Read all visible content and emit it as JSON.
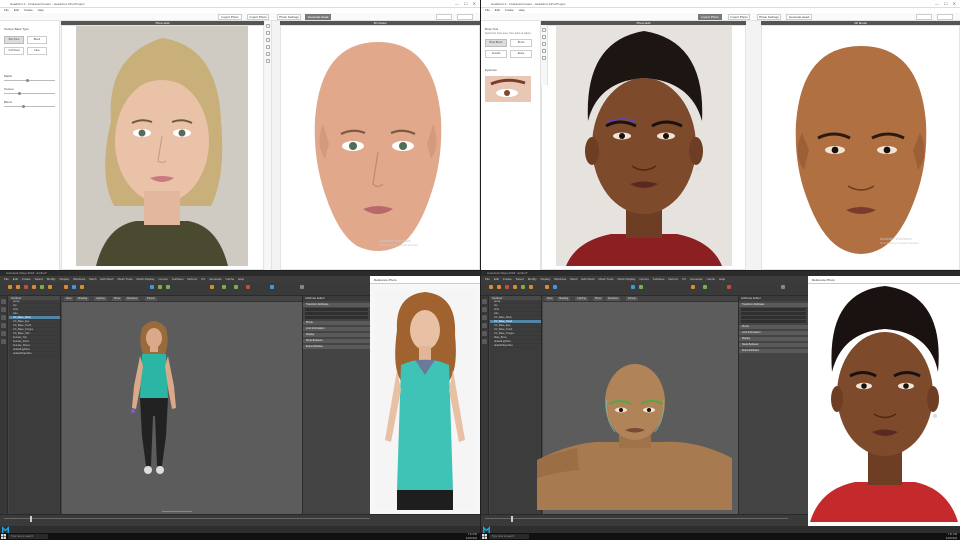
{
  "panels": {
    "top_left": {
      "title": "Headshot 2 - CharacterCreator - Headshot-AP.ccProject",
      "menu": [
        "File",
        "Edit",
        "Create",
        "Help"
      ],
      "toolbar": [
        "Import Photo",
        "Import Photo",
        "Photo Settings",
        "Generate Head"
      ],
      "photo_header": "Photo Edit",
      "result_header": "3D Model",
      "side": {
        "heading": "Texture Bake Type",
        "options": [
          "Skin Tone",
          "Blend",
          "Full Head",
          "Face"
        ],
        "sliders": [
          "Match",
          "Texture",
          "Blend"
        ]
      },
      "watermark_1": "Activate Windows",
      "watermark_2": "Go to Settings to activate Windows."
    },
    "top_right": {
      "title": "Headshot 2 - CharacterCreator - Headshot-AP.ccProject",
      "menu": [
        "File",
        "Edit",
        "Create",
        "Help"
      ],
      "toolbar": [
        "Import Photo",
        "Import Photo",
        "Photo Settings",
        "Generate Head"
      ],
      "photo_header": "Photo Edit",
      "result_header": "3D Model",
      "side": {
        "heading": "Brow Tool",
        "hint": "Select the brow area, then paint to adjust",
        "options": [
          "Brow Brush",
          "Brush",
          "Smooth",
          "Erase"
        ],
        "section": "Eyebrow"
      },
      "watermark_1": "Activate Windows",
      "watermark_2": "Go to Settings to activate Windows."
    },
    "bottom_left": {
      "title": "Autodesk Maya 2018: untitled*",
      "menu": [
        "File",
        "Edit",
        "Create",
        "Select",
        "Modify",
        "Display",
        "Windows",
        "Mesh",
        "Edit Mesh",
        "Mesh Tools",
        "Mesh Display",
        "Curves",
        "Surfaces",
        "Deform",
        "UV",
        "Generate",
        "Cache",
        "Help"
      ],
      "outliner_title": "Outliner",
      "outliner_rows": [
        "persp",
        "top",
        "front",
        "side",
        "CC_Base_Body",
        "CC_Base_Eye",
        "CC_Base_Teeth",
        "CC_Base_Tongue",
        "CC_Base_Hair",
        "Female_Top",
        "Female_Pants",
        "Female_Shoes",
        "defaultLightSet",
        "defaultObjectSet"
      ],
      "viewport_tabs": [
        "View",
        "Shading",
        "Lighting",
        "Show",
        "Renderer",
        "Panels"
      ],
      "attr_title": "Attribute Editor",
      "attr_sections": [
        "Transform Attributes",
        "Pivots",
        "Limit Information",
        "Display",
        "Node Behavior",
        "Extra Attributes"
      ],
      "ref_title": "Reference Photo",
      "ref_status": "Activate Windows",
      "search": "Type here to search",
      "clock_time": "7:24 PM",
      "clock_date": "4/18/2018"
    },
    "bottom_right": {
      "title": "Autodesk Maya 2018: untitled*",
      "menu": [
        "File",
        "Edit",
        "Create",
        "Select",
        "Modify",
        "Display",
        "Windows",
        "Mesh",
        "Edit Mesh",
        "Mesh Tools",
        "Mesh Display",
        "Curves",
        "Surfaces",
        "Deform",
        "UV",
        "Generate",
        "Cache",
        "Help"
      ],
      "outliner_title": "Outliner",
      "outliner_rows": [
        "persp",
        "top",
        "front",
        "side",
        "CC_Base_Body",
        "CC_Base_Head",
        "CC_Base_Eye",
        "CC_Base_Teeth",
        "CC_Base_Tongue",
        "Male_Brow",
        "defaultLightSet",
        "defaultObjectSet"
      ],
      "viewport_tabs": [
        "View",
        "Shading",
        "Lighting",
        "Show",
        "Renderer",
        "Panels"
      ],
      "attr_title": "Attribute Editor",
      "attr_sections": [
        "Transform Attributes",
        "Pivots",
        "Limit Information",
        "Display",
        "Node Behavior",
        "Extra Attributes"
      ],
      "ref_title": "Reference Photo",
      "search": "Type here to search",
      "clock_time": "7:31 PM",
      "clock_date": "4/18/2018"
    }
  },
  "colors": {
    "skin_light": "#e8b8a0",
    "skin_dark": "#8a5a3a",
    "maya_bg": "#5c5c5c",
    "accent_blue": "#5285a6",
    "maya_logo": "#1aa3d9",
    "top_green": "#3bc3bd"
  }
}
